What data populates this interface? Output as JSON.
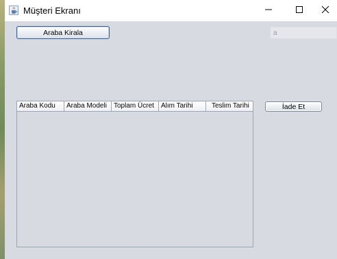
{
  "window": {
    "title": "Müşteri Ekranı",
    "icon": "java-cup-icon",
    "controls": {
      "minimize": "minimize-icon",
      "maximize": "maximize-icon",
      "close": "close-icon"
    }
  },
  "actions": {
    "rent_label": "Araba Kirala",
    "return_label": "İade Et"
  },
  "field": {
    "value": "a"
  },
  "table": {
    "columns": [
      "Araba Kodu",
      "Araba Modeli",
      "Toplam Ücret",
      "Alım Tarihi",
      "Teslim Tarihi"
    ],
    "rows": []
  },
  "colors": {
    "window_bg": "#d8dae2",
    "titlebar_bg": "#ffffff",
    "button_border": "#7a8a9c",
    "focused_button_border": "#3c5f8e"
  }
}
